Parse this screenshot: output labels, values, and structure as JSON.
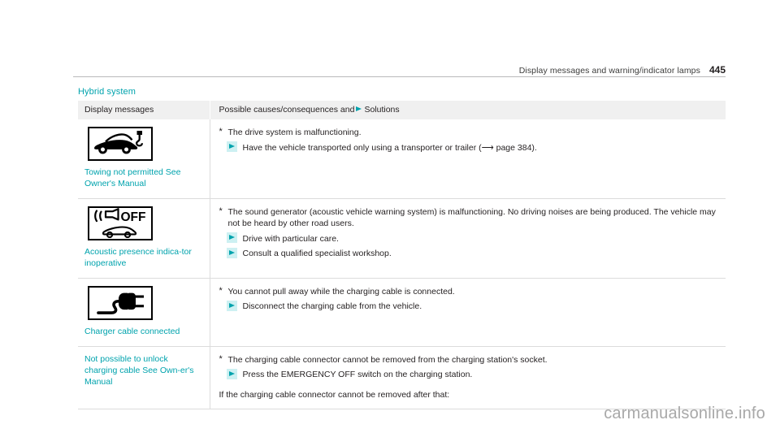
{
  "header": {
    "title": "Display messages and warning/indicator lamps",
    "page_number": "445"
  },
  "section": {
    "heading": "Hybrid system"
  },
  "table": {
    "columns": {
      "messages": "Display messages",
      "solutions_prefix": "Possible causes/consequences and",
      "solutions_suffix": "Solutions"
    },
    "rows": [
      {
        "icon": "towing-not-permitted-icon",
        "message": "Towing not permitted See Owner's Manual",
        "cause_marker": "*",
        "cause": "The drive system is malfunctioning.",
        "solutions": [
          "Have the vehicle transported only using a transporter or trailer (⟶ page 384)."
        ],
        "note": ""
      },
      {
        "icon": "acoustic-presence-off-icon",
        "message": "Acoustic presence indica-tor inoperative",
        "cause_marker": "*",
        "cause": "The sound generator (acoustic vehicle warning system) is malfunctioning. No driving noises are being produced. The vehicle may not be heard by other road users.",
        "solutions": [
          "Drive with particular care.",
          "Consult a qualified specialist workshop."
        ],
        "note": ""
      },
      {
        "icon": "charger-cable-plug-icon",
        "message": "Charger cable connected",
        "cause_marker": "*",
        "cause": "You cannot pull away while the charging cable is connected.",
        "solutions": [
          "Disconnect the charging cable from the vehicle."
        ],
        "note": ""
      },
      {
        "icon": "",
        "message": "Not possible to unlock charging cable See Own-er's Manual",
        "cause_marker": "*",
        "cause": "The charging cable connector cannot be removed from the charging station's socket.",
        "solutions": [
          "Press the EMERGENCY OFF switch on the charging station."
        ],
        "note": "If the charging cable connector cannot be removed after that:"
      }
    ]
  },
  "watermark": "carmanualsonline.info",
  "colors": {
    "accent_teal": "#00a3ad",
    "marker_background": "#cdf0f2",
    "header_row_background": "#f0f0f0",
    "body_text": "#231f20",
    "rule_gray": "#dcdcdc"
  }
}
